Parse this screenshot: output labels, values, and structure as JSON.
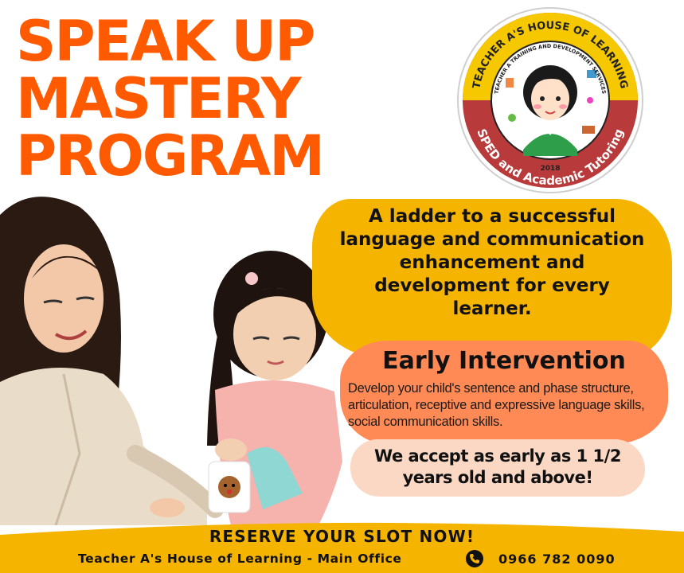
{
  "headline": {
    "line1": "SPEAK UP",
    "line2": "MASTERY",
    "line3": "PROGRAM"
  },
  "logo": {
    "arc_top": "TEACHER A'S HOUSE OF LEARNING",
    "arc_inner": "TEACHER A TRAINING AND DEVELOPMENT SERVICES",
    "arc_bottom": "SPED and Academic Tutoring",
    "year": "2018"
  },
  "tagline": "A ladder to a successful language and communication enhancement and development for every learner.",
  "early_intervention": {
    "title": "Early Intervention",
    "description": "Develop your child's  sentence and phase structure, articulation, receptive and expressive language skills, social communication skills."
  },
  "age_note": "We accept as early as 1 1/2 years old and above!",
  "footer": {
    "cta": "RESERVE YOUR SLOT NOW!",
    "office": "Teacher A's House of Learning - Main Office",
    "phone": "0966 782 0090",
    "phone_icon": "phone-icon"
  },
  "colors": {
    "headline_orange": "#ff5a00",
    "tagline_yellow": "#f5b400",
    "intervention_orange": "#ff8a55",
    "age_peach": "#fbd8c4",
    "footer_yellow": "#f5b400",
    "logo_red": "#b83a3a"
  }
}
